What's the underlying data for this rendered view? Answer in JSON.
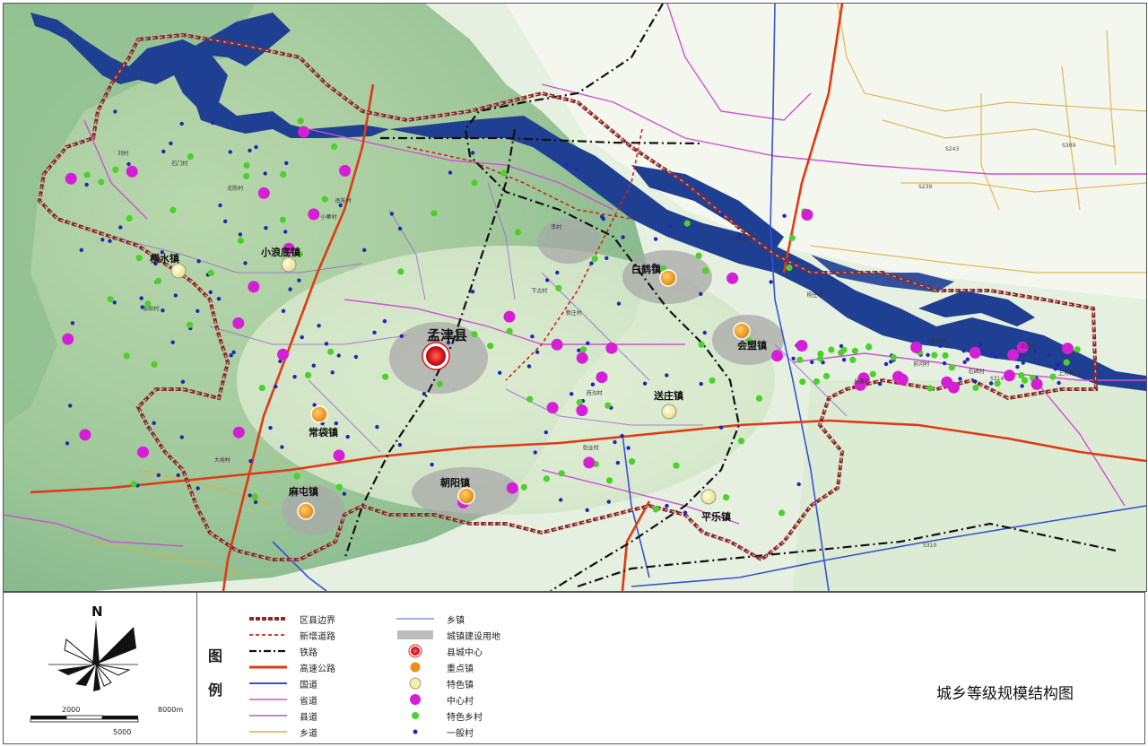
{
  "map": {
    "county_seat": {
      "label": "孟津县"
    },
    "key_towns": [
      {
        "label": "白鹤镇"
      },
      {
        "label": "会盟镇"
      },
      {
        "label": "常袋镇"
      },
      {
        "label": "朝阳镇"
      },
      {
        "label": "麻屯镇"
      }
    ],
    "featured_towns": [
      {
        "label": "横水镇"
      },
      {
        "label": "小浪底镇"
      },
      {
        "label": "送庄镇"
      },
      {
        "label": "平乐镇"
      }
    ],
    "road_labels": [
      "S314",
      "S239",
      "S310",
      "S309",
      "S243"
    ],
    "village_labels": [
      "大峪村",
      "寺沟村",
      "上河村",
      "东岭村",
      "西沟村",
      "张庄村",
      "马屯村",
      "王庄村",
      "李村",
      "后寨村",
      "前河村",
      "新庄村",
      "南陈村",
      "北陈村",
      "石碑村",
      "下古村",
      "小寨村",
      "石门村",
      "杨庄村",
      "刘村"
    ]
  },
  "legend": {
    "heading_chars": [
      "图",
      "例"
    ],
    "left_items": [
      {
        "key": "district_boundary",
        "label": "区县边界"
      },
      {
        "key": "new_road",
        "label": "新增道路"
      },
      {
        "key": "railway",
        "label": "铁路"
      },
      {
        "key": "expressway",
        "label": "高速公路"
      },
      {
        "key": "national_road",
        "label": "国道"
      },
      {
        "key": "provincial_road",
        "label": "省道"
      },
      {
        "key": "county_road",
        "label": "县道"
      },
      {
        "key": "township_road",
        "label": "乡道"
      }
    ],
    "right_items": [
      {
        "key": "township",
        "label": "乡镇"
      },
      {
        "key": "built_up_land",
        "label": "城镇建设用地"
      },
      {
        "key": "county_center",
        "label": "县城中心"
      },
      {
        "key": "key_town",
        "label": "重点镇"
      },
      {
        "key": "featured_town",
        "label": "特色镇"
      },
      {
        "key": "central_village",
        "label": "中心村"
      },
      {
        "key": "featured_village",
        "label": "特色乡村"
      },
      {
        "key": "general_village",
        "label": "一般村"
      }
    ]
  },
  "compass": {
    "north_label": "N"
  },
  "scale_bar": {
    "label_left": "2000",
    "label_right": "8000m",
    "label_bottom": "5000"
  },
  "title": "城乡等级规模结构图",
  "colors": {
    "boundary": "#8b2a2a",
    "new_road": "#d42020",
    "expressway": "#e03a14",
    "national_road": "#3552d6",
    "provincial_road": "#d150d6",
    "county_road": "#9a63d0",
    "township_road": "#d8b040",
    "river": "#1f3f93",
    "county_center": "#e0141a",
    "key_town": "#e8901a",
    "featured_town": "#f4f0a8",
    "central_village": "#d61ed6",
    "featured_village": "#4ad12a",
    "general_village": "#2424b8"
  }
}
